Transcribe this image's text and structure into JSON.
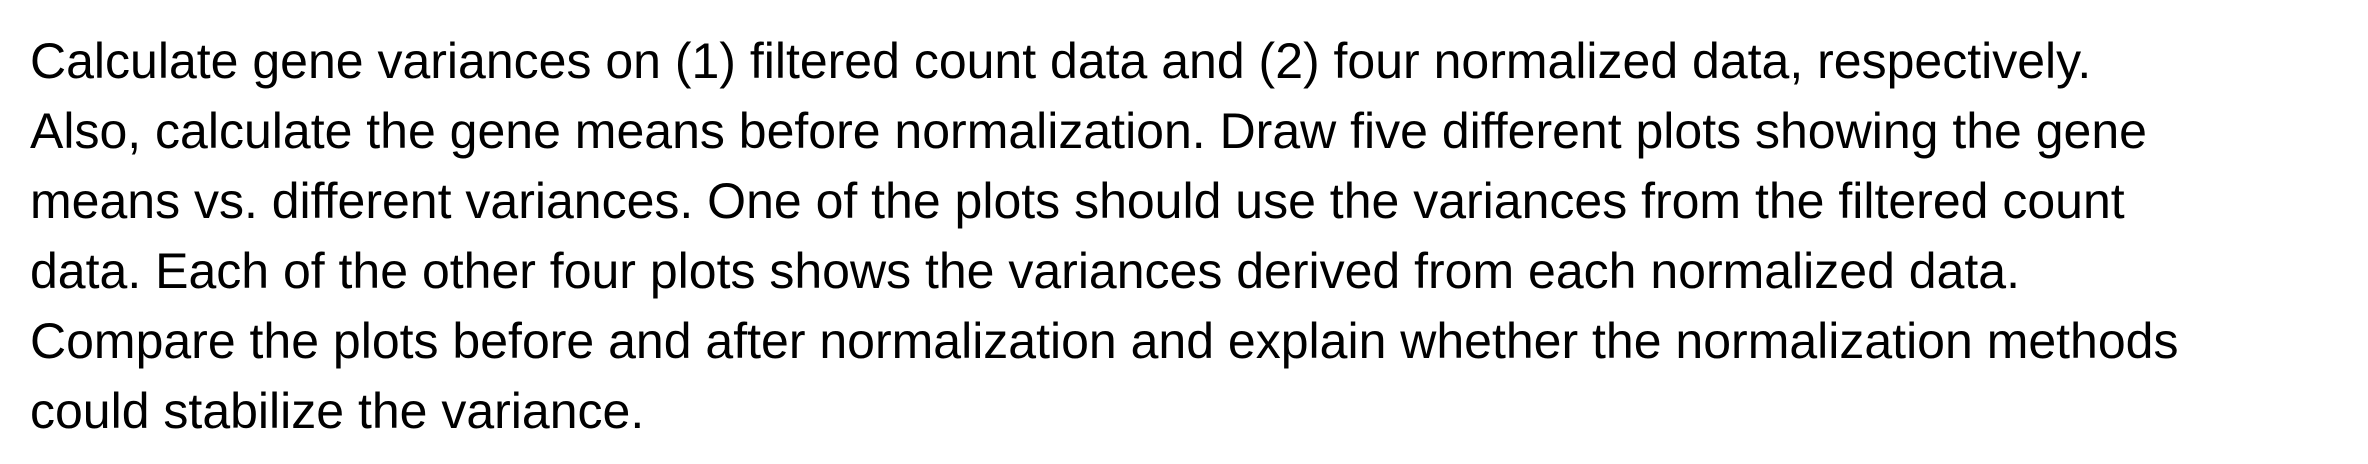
{
  "document": {
    "lines": [
      "Calculate gene variances on (1) filtered count data and (2) four normalized data, respectively.",
      "Also, calculate the gene means before normalization. Draw five different plots showing the gene",
      "means vs. different variances. One of the plots should use the variances from the filtered count",
      "data. Each of the other four plots shows the variances derived from each normalized data.",
      "Compare the plots before and after normalization and explain whether the normalization methods",
      "could stabilize the variance."
    ]
  },
  "colors": {
    "background": "#ffffff",
    "text": "#000000"
  }
}
